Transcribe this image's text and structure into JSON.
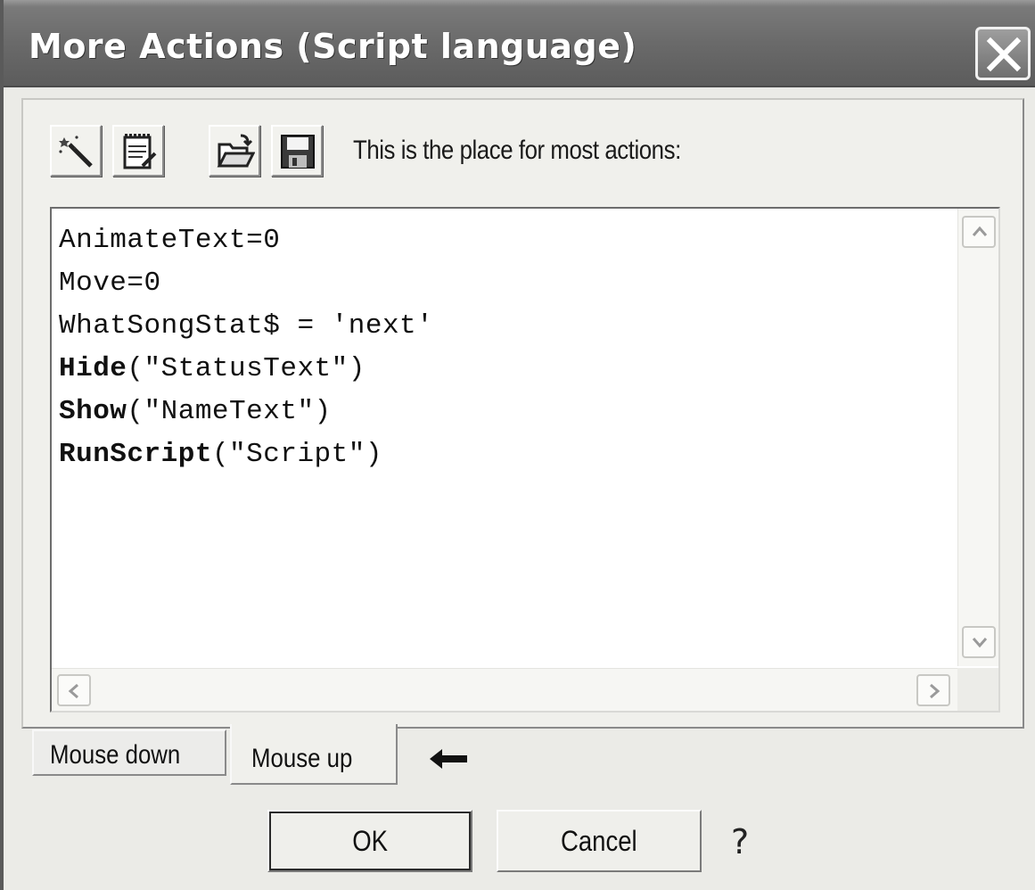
{
  "window": {
    "title": "More Actions (Script language)",
    "close_icon": "close-icon"
  },
  "toolbar": {
    "buttons": [
      {
        "name": "magic-wand-icon"
      },
      {
        "name": "notepad-icon"
      },
      {
        "name": "open-folder-icon"
      },
      {
        "name": "save-disk-icon"
      }
    ],
    "label": "This is the place for most actions:"
  },
  "editor": {
    "lines": [
      {
        "keyword": "",
        "rest": "AnimateText=0"
      },
      {
        "keyword": "",
        "rest": "Move=0"
      },
      {
        "keyword": "",
        "rest": "WhatSongStat$ = 'next'"
      },
      {
        "keyword": "Hide",
        "rest": "(\"StatusText\")"
      },
      {
        "keyword": "Show",
        "rest": "(\"NameText\")"
      },
      {
        "keyword": "RunScript",
        "rest": "(\"Script\")"
      }
    ]
  },
  "tabs": {
    "mouse_down": "Mouse down",
    "mouse_up": "Mouse up",
    "selected": "Mouse up"
  },
  "buttons": {
    "ok": "OK",
    "cancel": "Cancel",
    "help": "?"
  }
}
